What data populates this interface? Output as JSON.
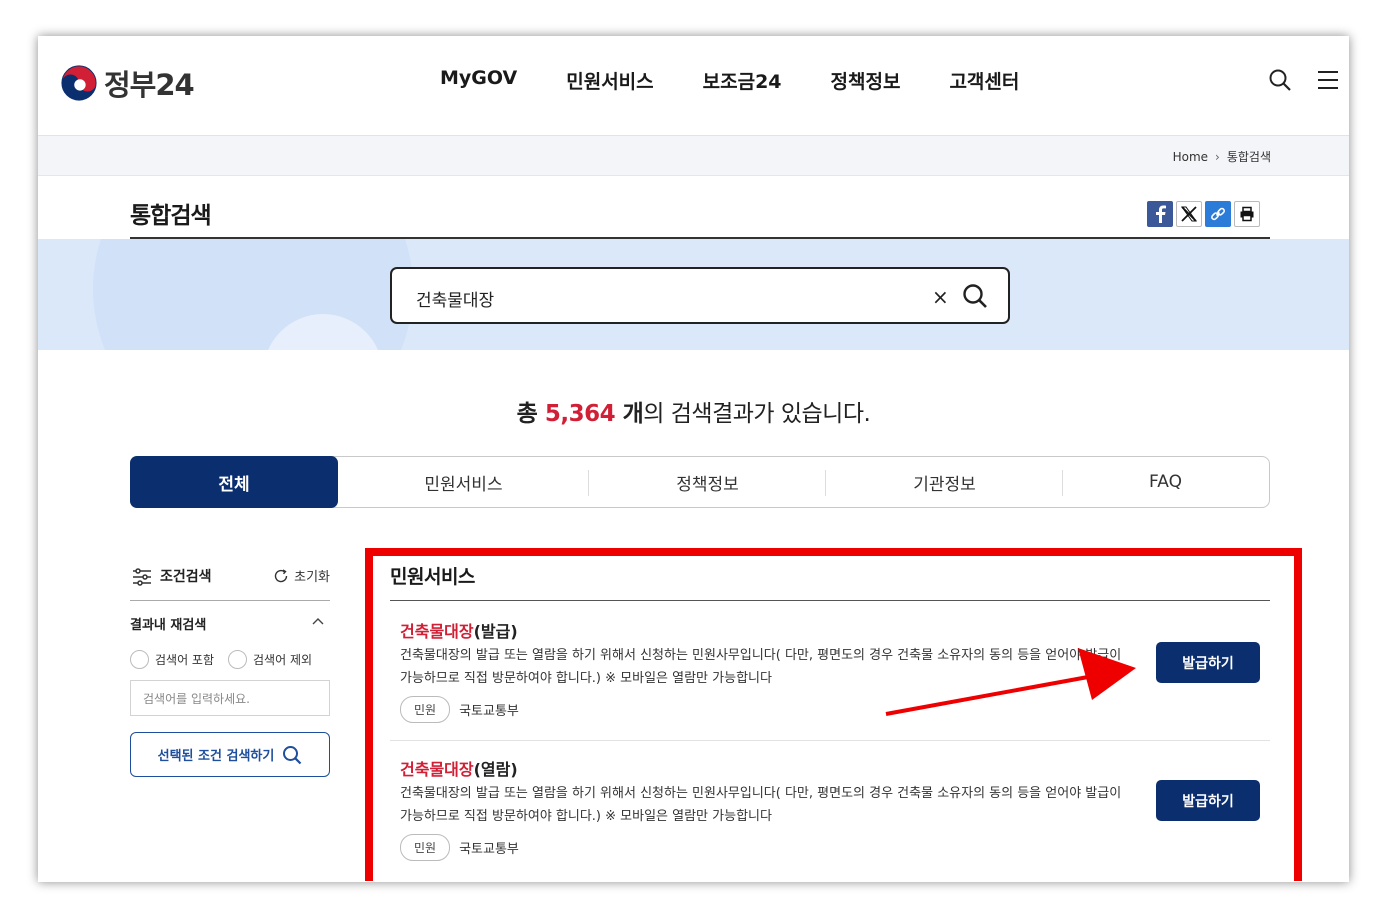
{
  "header": {
    "logo_text": "정부24",
    "nav": [
      "MyGOV",
      "민원서비스",
      "보조금24",
      "정책정보",
      "고객센터"
    ]
  },
  "breadcrumb": {
    "home": "Home",
    "current": "통합검색"
  },
  "page_title": "통합검색",
  "search": {
    "value": "건축물대장",
    "clear": "×"
  },
  "result_count": {
    "prefix": "총 ",
    "number": "5,364",
    "unit": " 개",
    "suffix": "의 검색결과가 있습니다."
  },
  "tabs": [
    "전체",
    "민원서비스",
    "정책정보",
    "기관정보",
    "FAQ"
  ],
  "filter": {
    "title": "조건검색",
    "reset": "초기화",
    "subhead": "결과내 재검색",
    "radio_include": "검색어 포함",
    "radio_exclude": "검색어 제외",
    "input_placeholder": "검색어를 입력하세요.",
    "submit": "선택된 조건 검색하기"
  },
  "results": {
    "section_title": "민원서비스",
    "items": [
      {
        "title_hl": "건축물대장",
        "title_rest": "(발급)",
        "desc": "건축물대장의 발급 또는 열람을 하기 위해서 신청하는 민원사무입니다( 다만, 평면도의 경우 건축물 소유자의 동의 등을 얻어야 발급이 가능하므로 직접 방문하여야 합니다.) ※ 모바일은 열람만 가능합니다",
        "badge": "민원",
        "org": "국토교통부",
        "button": "발급하기"
      },
      {
        "title_hl": "건축물대장",
        "title_rest": "(열람)",
        "desc": "건축물대장의 발급 또는 열람을 하기 위해서 신청하는 민원사무입니다( 다만, 평면도의 경우 건축물 소유자의 동의 등을 얻어야 발급이 가능하므로 직접 방문하여야 합니다.) ※ 모바일은 열람만 가능합니다",
        "badge": "민원",
        "org": "국토교통부",
        "button": "발급하기"
      }
    ]
  },
  "colors": {
    "navy": "#0b2e6e",
    "highlight_red": "#d11f36",
    "annotation_red": "#ee0000",
    "band": "#dbe8fa"
  },
  "icons": [
    "taegeuk-logo-icon",
    "search-icon",
    "menu-icon",
    "facebook-icon",
    "x-icon",
    "link-icon",
    "print-icon",
    "close-icon",
    "filter-sliders-icon",
    "refresh-icon",
    "chevron-up-icon",
    "arrow-annotation-icon"
  ]
}
